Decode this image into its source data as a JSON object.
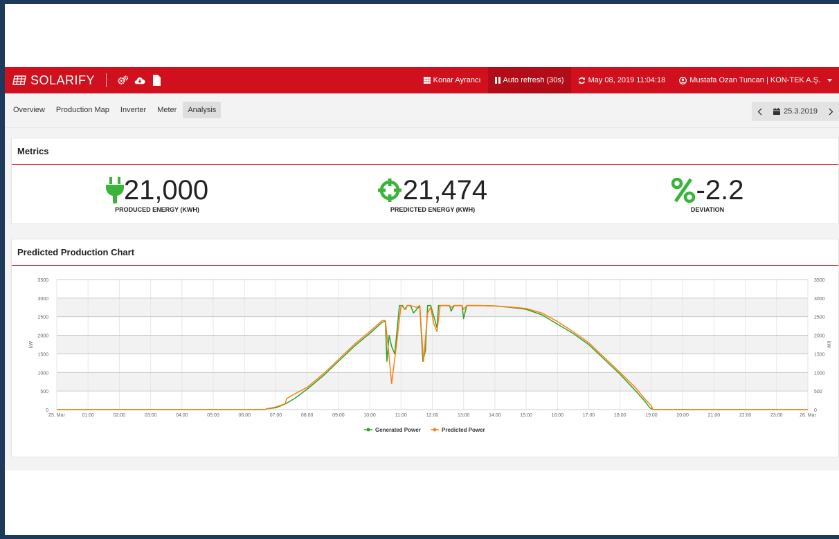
{
  "app": {
    "brand": "SOLARIFY"
  },
  "navbar": {
    "plant": "Konar Ayrancı",
    "refresh": "Auto refresh (30s)",
    "datetime": "May 08, 2019 11:04:18",
    "user": "Mustafa Ozan Tuncan | KON-TEK A.Ş."
  },
  "tabs": [
    {
      "label": "Overview"
    },
    {
      "label": "Production Map"
    },
    {
      "label": "Inverter"
    },
    {
      "label": "Meter"
    },
    {
      "label": "Analysis"
    }
  ],
  "date_nav": {
    "date": "25.3.2019"
  },
  "metrics": {
    "title": "Metrics",
    "produced": {
      "value": "21,000",
      "label": "PRODUCED ENERGY (KWH)"
    },
    "predicted": {
      "value": "21,474",
      "label": "PREDICTED ENERGY (KWH)"
    },
    "deviation": {
      "value": "-2.2",
      "label": "DEVIATION"
    }
  },
  "colors": {
    "brand": "#d0101d",
    "icon_green": "#3bb43a",
    "generated": "#2ca02c",
    "predicted": "#ff7f0e"
  },
  "chart_panel": {
    "title": "Predicted Production Chart"
  },
  "chart_data": {
    "type": "line",
    "title": "",
    "ylabel": "kW",
    "y2label": "kW",
    "ylim": [
      0,
      3500
    ],
    "xlim": [
      0,
      24
    ],
    "grid": true,
    "legend": "bottom",
    "yticks": [
      0,
      500,
      1000,
      1500,
      2000,
      2500,
      3000,
      3500
    ],
    "xticks": [
      {
        "x": 0,
        "label": "25. Mar"
      },
      {
        "x": 1,
        "label": "01:00"
      },
      {
        "x": 2,
        "label": "02:00"
      },
      {
        "x": 3,
        "label": "03:00"
      },
      {
        "x": 4,
        "label": "04:00"
      },
      {
        "x": 5,
        "label": "05:00"
      },
      {
        "x": 6,
        "label": "06:00"
      },
      {
        "x": 7,
        "label": "07:00"
      },
      {
        "x": 8,
        "label": "08:00"
      },
      {
        "x": 9,
        "label": "09:00"
      },
      {
        "x": 10,
        "label": "10:00"
      },
      {
        "x": 11,
        "label": "11:00"
      },
      {
        "x": 12,
        "label": "12:00"
      },
      {
        "x": 13,
        "label": "13:00"
      },
      {
        "x": 14,
        "label": "14:00"
      },
      {
        "x": 15,
        "label": "15:00"
      },
      {
        "x": 16,
        "label": "16:00"
      },
      {
        "x": 17,
        "label": "17:00"
      },
      {
        "x": 18,
        "label": "18:00"
      },
      {
        "x": 19,
        "label": "19:00"
      },
      {
        "x": 20,
        "label": "20:00"
      },
      {
        "x": 21,
        "label": "21:00"
      },
      {
        "x": 22,
        "label": "22:00"
      },
      {
        "x": 23,
        "label": "23:00"
      },
      {
        "x": 24,
        "label": "26. Mar"
      }
    ],
    "series": [
      {
        "name": "Generated Power",
        "points": [
          [
            0,
            0
          ],
          [
            6.65,
            0
          ],
          [
            6.7,
            20
          ],
          [
            7.0,
            50
          ],
          [
            7.3,
            150
          ],
          [
            7.6,
            300
          ],
          [
            8.0,
            550
          ],
          [
            8.5,
            900
          ],
          [
            9.0,
            1300
          ],
          [
            9.5,
            1700
          ],
          [
            10.0,
            2050
          ],
          [
            10.4,
            2350
          ],
          [
            10.5,
            2380
          ],
          [
            10.55,
            1300
          ],
          [
            10.62,
            2000
          ],
          [
            10.7,
            1700
          ],
          [
            10.8,
            1500
          ],
          [
            10.95,
            2800
          ],
          [
            11.05,
            2800
          ],
          [
            11.12,
            2700
          ],
          [
            11.2,
            2800
          ],
          [
            11.3,
            2800
          ],
          [
            11.4,
            2600
          ],
          [
            11.5,
            2700
          ],
          [
            11.6,
            2780
          ],
          [
            11.7,
            1300
          ],
          [
            11.78,
            1600
          ],
          [
            11.85,
            2800
          ],
          [
            11.95,
            2800
          ],
          [
            12.05,
            2500
          ],
          [
            12.15,
            2200
          ],
          [
            12.2,
            2800
          ],
          [
            12.3,
            2800
          ],
          [
            12.55,
            2800
          ],
          [
            12.6,
            2650
          ],
          [
            12.7,
            2800
          ],
          [
            12.95,
            2800
          ],
          [
            13.0,
            2450
          ],
          [
            13.1,
            2800
          ],
          [
            13.5,
            2800
          ],
          [
            14.0,
            2790
          ],
          [
            14.5,
            2750
          ],
          [
            15.0,
            2700
          ],
          [
            15.5,
            2550
          ],
          [
            16.0,
            2300
          ],
          [
            16.5,
            2050
          ],
          [
            17.0,
            1750
          ],
          [
            17.5,
            1350
          ],
          [
            18.0,
            950
          ],
          [
            18.5,
            500
          ],
          [
            18.8,
            220
          ],
          [
            18.95,
            50
          ],
          [
            19.05,
            0
          ],
          [
            24,
            0
          ]
        ]
      },
      {
        "name": "Predicted Power",
        "points": [
          [
            0,
            0
          ],
          [
            6.65,
            0
          ],
          [
            6.7,
            20
          ],
          [
            7.0,
            70
          ],
          [
            7.3,
            160
          ],
          [
            7.35,
            300
          ],
          [
            7.6,
            420
          ],
          [
            8.0,
            600
          ],
          [
            8.5,
            950
          ],
          [
            9.0,
            1350
          ],
          [
            9.5,
            1750
          ],
          [
            10.0,
            2100
          ],
          [
            10.4,
            2400
          ],
          [
            10.5,
            2400
          ],
          [
            10.6,
            1600
          ],
          [
            10.7,
            700
          ],
          [
            10.85,
            1700
          ],
          [
            11.0,
            2800
          ],
          [
            11.15,
            2700
          ],
          [
            11.2,
            2800
          ],
          [
            11.3,
            2800
          ],
          [
            11.5,
            2750
          ],
          [
            11.6,
            2800
          ],
          [
            11.72,
            1300
          ],
          [
            11.85,
            2600
          ],
          [
            11.95,
            2750
          ],
          [
            12.05,
            2300
          ],
          [
            12.15,
            2100
          ],
          [
            12.25,
            2800
          ],
          [
            12.55,
            2800
          ],
          [
            12.6,
            2750
          ],
          [
            12.7,
            2800
          ],
          [
            12.95,
            2800
          ],
          [
            13.0,
            2700
          ],
          [
            13.1,
            2800
          ],
          [
            13.5,
            2800
          ],
          [
            14.0,
            2790
          ],
          [
            14.5,
            2760
          ],
          [
            15.0,
            2720
          ],
          [
            15.5,
            2600
          ],
          [
            16.0,
            2370
          ],
          [
            16.5,
            2100
          ],
          [
            17.0,
            1800
          ],
          [
            17.5,
            1400
          ],
          [
            18.0,
            1000
          ],
          [
            18.5,
            580
          ],
          [
            18.8,
            280
          ],
          [
            19.0,
            100
          ],
          [
            19.05,
            0
          ],
          [
            24,
            0
          ]
        ]
      }
    ]
  }
}
